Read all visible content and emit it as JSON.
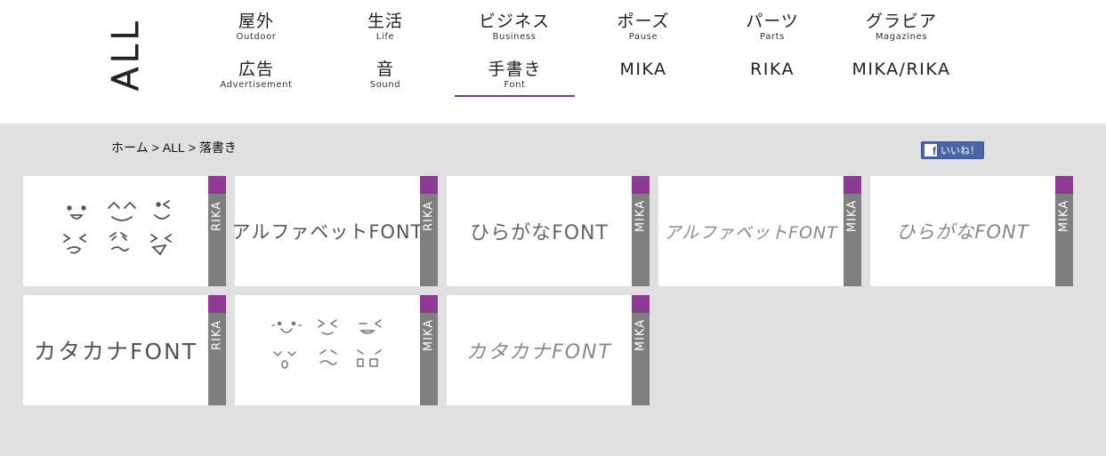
{
  "logo": {
    "text": "ALL"
  },
  "nav": [
    {
      "jp": "屋外",
      "en": "Outdoor"
    },
    {
      "jp": "生活",
      "en": "Life"
    },
    {
      "jp": "ビジネス",
      "en": "Business"
    },
    {
      "jp": "ポーズ",
      "en": "Pause"
    },
    {
      "jp": "パーツ",
      "en": "Parts"
    },
    {
      "jp": "グラビア",
      "en": "Magazines"
    },
    {
      "jp": "広告",
      "en": "Advertisement"
    },
    {
      "jp": "音",
      "en": "Sound"
    },
    {
      "jp": "手書き",
      "en": "Font"
    },
    {
      "jp": "MIKA"
    },
    {
      "jp": "RIKA"
    },
    {
      "jp": "MIKA/RIKA"
    }
  ],
  "breadcrumb": {
    "home": "ホーム",
    "sep": ">",
    "all": "ALL",
    "current": "落書き"
  },
  "like_button": {
    "label": "いいね！",
    "icon": "f"
  },
  "cards": [
    {
      "tag": "RIKA"
    },
    {
      "tag": "RIKA",
      "text": "アルファベットFONT"
    },
    {
      "tag": "MIKA",
      "text": "ひらがなFONT"
    },
    {
      "tag": "MIKA",
      "text": "アルファベットFONT"
    },
    {
      "tag": "MIKA",
      "text": "ひらがなFONT"
    },
    {
      "tag": "RIKA",
      "text": "カタカナFONT"
    },
    {
      "tag": "MIKA"
    },
    {
      "tag": "MIKA",
      "text": "カタカナFONT"
    }
  ],
  "colors": {
    "accent": "#8e3a95",
    "tag_gray": "#7f7f7f",
    "background": "#e0e0e0",
    "facebook": "#4a64a8"
  }
}
